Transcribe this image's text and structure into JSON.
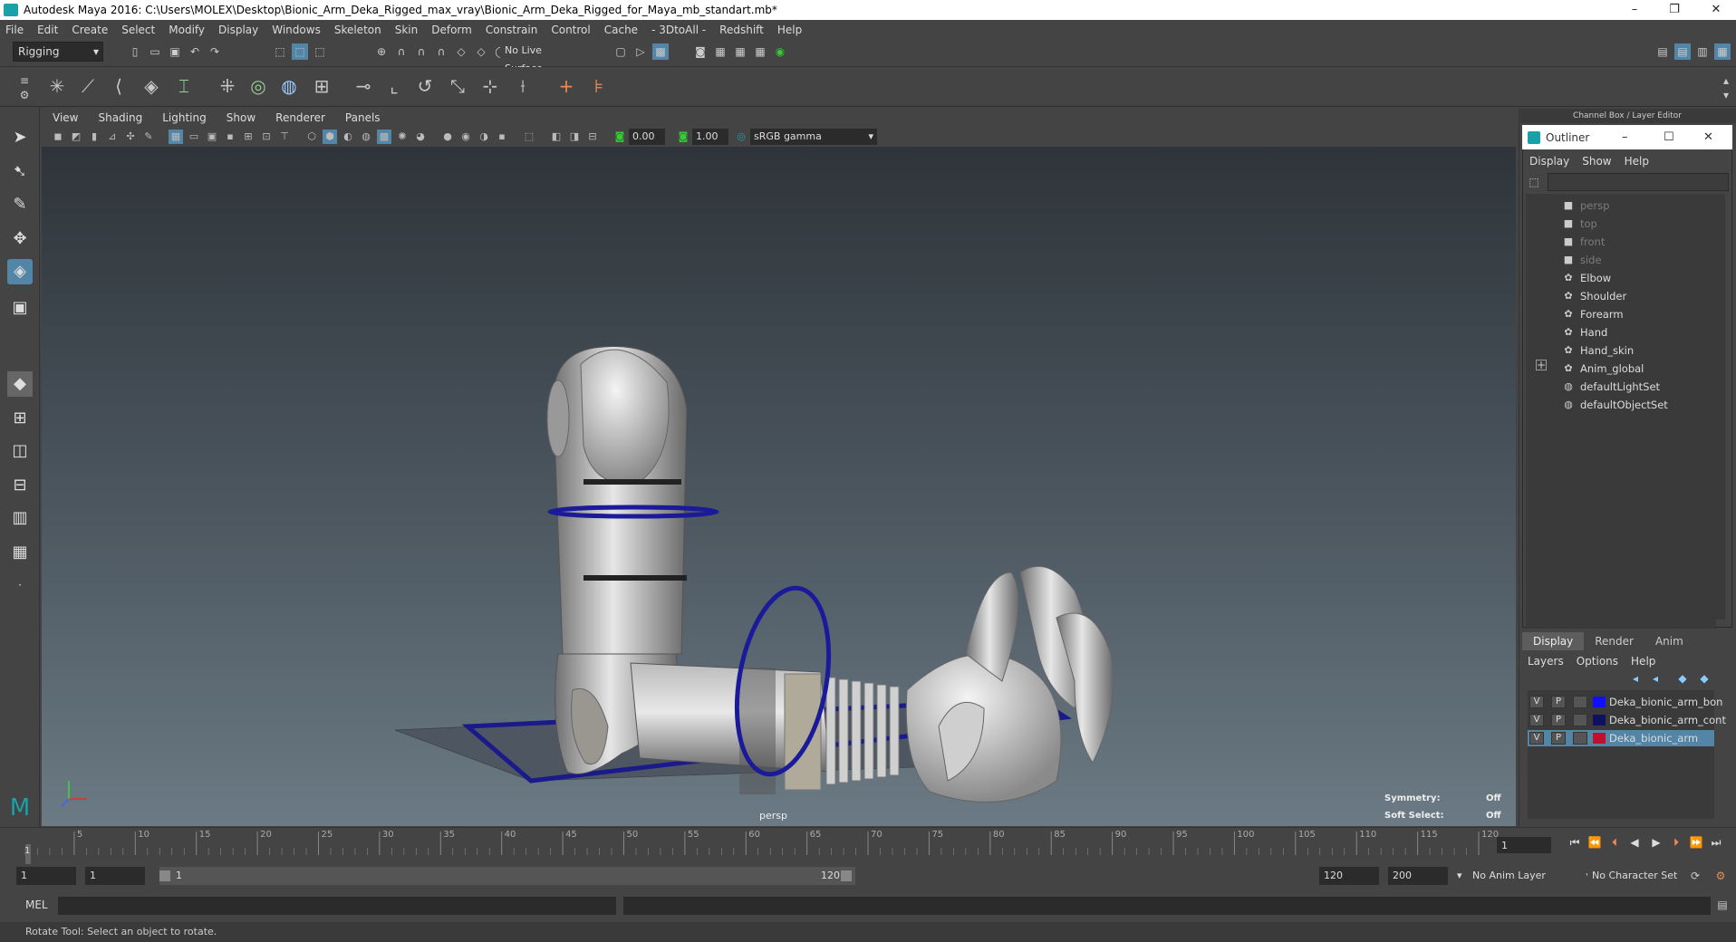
{
  "window": {
    "title": "Autodesk Maya 2016: C:\\Users\\MOLEX\\Desktop\\Bionic_Arm_Deka_Rigged_max_vray\\Bionic_Arm_Deka_Rigged_for_Maya_mb_standart.mb*",
    "minimize": "–",
    "restore": "❐",
    "close": "✕"
  },
  "menubar": [
    "File",
    "Edit",
    "Create",
    "Select",
    "Modify",
    "Display",
    "Windows",
    "Skeleton",
    "Skin",
    "Deform",
    "Constrain",
    "Control",
    "Cache",
    "- 3DtoAll -",
    "Redshift",
    "Help"
  ],
  "statusline": {
    "menuset": "Rigging",
    "live_surface": "No Live Surface"
  },
  "viewport": {
    "menu": [
      "View",
      "Shading",
      "Lighting",
      "Show",
      "Renderer",
      "Panels"
    ],
    "exposure": "0.00",
    "gamma": "1.00",
    "colorspace": "sRGB gamma",
    "camera_label": "persp",
    "symmetry_label": "Symmetry:",
    "symmetry_value": "Off",
    "softselect_label": "Soft Select:",
    "softselect_value": "Off"
  },
  "channel_box_title": "Channel Box / Layer Editor",
  "outliner": {
    "title": "Outliner",
    "menu": [
      "Display",
      "Show",
      "Help"
    ],
    "items": [
      {
        "label": "persp",
        "dim": true,
        "icon": "camera-icon"
      },
      {
        "label": "top",
        "dim": true,
        "icon": "camera-icon"
      },
      {
        "label": "front",
        "dim": true,
        "icon": "camera-icon"
      },
      {
        "label": "side",
        "dim": true,
        "icon": "camera-icon"
      },
      {
        "label": "Elbow",
        "dim": false,
        "icon": "transform-icon"
      },
      {
        "label": "Shoulder",
        "dim": false,
        "icon": "transform-icon"
      },
      {
        "label": "Forearm",
        "dim": false,
        "icon": "transform-icon"
      },
      {
        "label": "Hand",
        "dim": false,
        "icon": "transform-icon"
      },
      {
        "label": "Hand_skin",
        "dim": false,
        "icon": "transform-icon"
      },
      {
        "label": "Anim_global",
        "dim": false,
        "icon": "transform-icon"
      },
      {
        "label": "defaultLightSet",
        "dim": false,
        "icon": "set-icon"
      },
      {
        "label": "defaultObjectSet",
        "dim": false,
        "icon": "set-icon"
      }
    ]
  },
  "layer_editor": {
    "tabs": [
      "Display",
      "Render",
      "Anim"
    ],
    "menu": [
      "Layers",
      "Options",
      "Help"
    ],
    "layers": [
      {
        "v": "V",
        "p": "P",
        "name": "Deka_bionic_arm_bon",
        "color": "#1010ff",
        "selected": false
      },
      {
        "v": "V",
        "p": "P",
        "name": "Deka_bionic_arm_cont",
        "color": "#101060",
        "selected": false
      },
      {
        "v": "V",
        "p": "P",
        "name": "Deka_bionic_arm",
        "color": "#c01030",
        "selected": true
      }
    ]
  },
  "timeline": {
    "ticks": [
      "5",
      "10",
      "15",
      "20",
      "25",
      "30",
      "35",
      "40",
      "45",
      "50",
      "55",
      "60",
      "65",
      "70",
      "75",
      "80",
      "85",
      "90",
      "95",
      "100",
      "105",
      "110",
      "115",
      "120"
    ],
    "start_marker": "1",
    "current_frame": "1"
  },
  "range": {
    "start": "1",
    "playback_start": "1",
    "slider_start": "1",
    "slider_end": "120",
    "playback_end": "120",
    "end": "200",
    "anim_layer": "No Anim Layer",
    "character_set": "No Character Set"
  },
  "command_line": {
    "label": "MEL"
  },
  "helpline": "Rotate Tool: Select an object to rotate."
}
